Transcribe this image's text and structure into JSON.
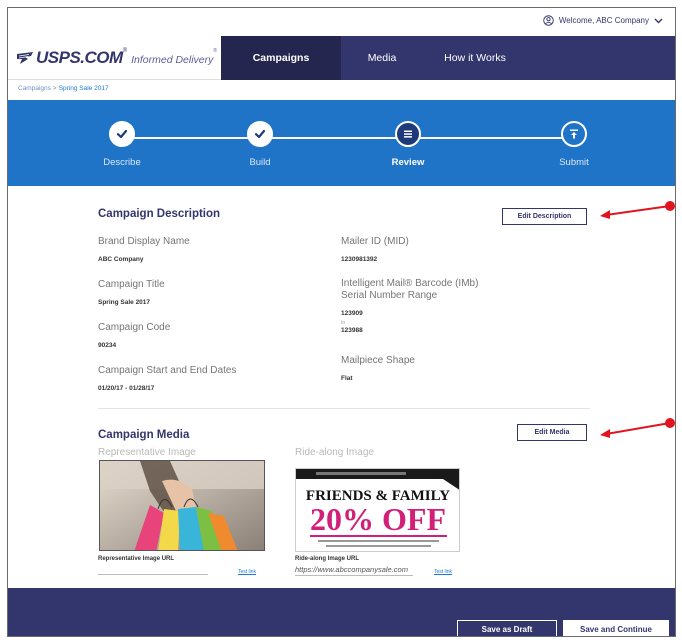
{
  "header": {
    "welcome_text": "Welcome, ABC Company",
    "logo_brand": "USPS.COM",
    "logo_reg": "®",
    "logo_product": "Informed Delivery",
    "logo_product_reg": "®",
    "nav": [
      "Campaigns",
      "Media",
      "How it Works"
    ],
    "active_nav": "Campaigns"
  },
  "breadcrumb": {
    "root": "Campaigns",
    "separator": ">",
    "current": "Spring Sale 2017"
  },
  "stepper": {
    "steps": [
      {
        "label": "Describe",
        "state": "done",
        "icon": "check-icon"
      },
      {
        "label": "Build",
        "state": "done",
        "icon": "check-icon"
      },
      {
        "label": "Review",
        "state": "current",
        "icon": "list-icon"
      },
      {
        "label": "Submit",
        "state": "pending",
        "icon": "upload-icon"
      }
    ]
  },
  "description": {
    "title": "Campaign Description",
    "edit_label": "Edit Description",
    "brand_name_label": "Brand Display Name",
    "brand_name_value": "ABC Company",
    "campaign_title_label": "Campaign Title",
    "campaign_title_value": "Spring Sale 2017",
    "campaign_code_label": "Campaign Code",
    "campaign_code_value": "90234",
    "dates_label": "Campaign Start and End Dates",
    "dates_value": "01/20/17 - 01/28/17",
    "mailer_id_label": "Mailer ID (MID)",
    "mailer_id_value": "1230981392",
    "imb_label_1": "Intelligent Mail® Barcode (IMb)",
    "imb_label_2": "Serial Number Range",
    "imb_from": "123909",
    "imb_to_word": "to",
    "imb_to": "123988",
    "shape_label": "Mailpiece Shape",
    "shape_value": "Flat"
  },
  "media": {
    "title": "Campaign Media",
    "edit_label": "Edit Media",
    "rep_label": "Representative Image",
    "ride_label": "Ride-along Image",
    "rep_url_label": "Representative Image URL",
    "rep_link": "Test link",
    "ride_url_label": "Ride-along Image URL",
    "ride_url_value": "https://www.abccompanysale.com",
    "ride_link": "Test link",
    "ad_headline_1": "FRIENDS & FAMILY",
    "ad_headline_2": "20% OFF"
  },
  "footer": {
    "draft_label": "Save as Draft",
    "continue_label": "Save and Continue"
  },
  "colors": {
    "navy": "#33366d",
    "blue": "#1f74c7",
    "annotation": "#e0141e"
  }
}
